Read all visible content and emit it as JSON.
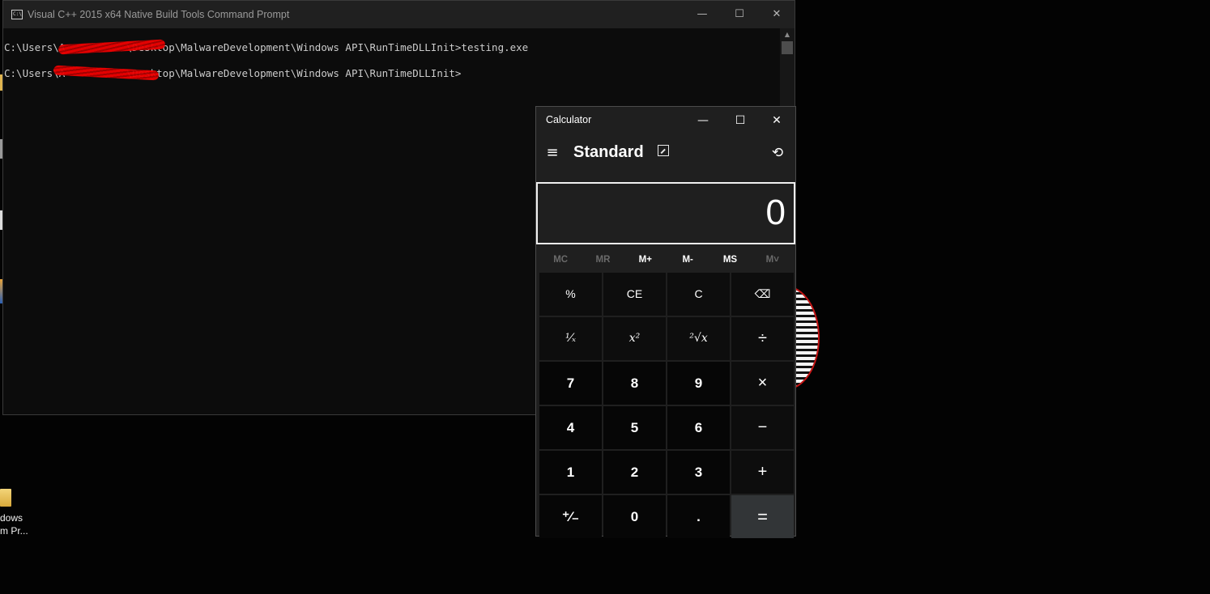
{
  "desktop": {
    "icon_label_line1": "dows",
    "icon_label_line2": "m Pr..."
  },
  "console": {
    "title": "Visual C++ 2015 x64 Native Build Tools Command Prompt",
    "icon_text": "C:\\",
    "controls": {
      "minimize": "—",
      "maximize": "☐",
      "close": "✕"
    },
    "lines": [
      "C:\\Users\\A          \\Desktop\\MalwareDevelopment\\Windows API\\RunTimeDLLInit>testing.exe",
      "C:\\Users\\A          \\Desktop\\MalwareDevelopment\\Windows API\\RunTimeDLLInit>"
    ],
    "scroll_up": "▲"
  },
  "calculator": {
    "title": "Calculator",
    "controls": {
      "minimize": "—",
      "maximize": "☐",
      "close": "✕"
    },
    "menu_icon": "≡",
    "mode": "Standard",
    "history_icon": "⟲",
    "display": "0",
    "memory": [
      {
        "label": "MC",
        "enabled": false
      },
      {
        "label": "MR",
        "enabled": false
      },
      {
        "label": "M+",
        "enabled": true
      },
      {
        "label": "M-",
        "enabled": true
      },
      {
        "label": "MS",
        "enabled": true
      },
      {
        "label": "M˅",
        "enabled": false
      }
    ],
    "keys": [
      {
        "label": "%",
        "kind": "fn",
        "name": "percent"
      },
      {
        "label": "CE",
        "kind": "fn",
        "name": "clear-entry"
      },
      {
        "label": "C",
        "kind": "fn",
        "name": "clear"
      },
      {
        "label": "⌫",
        "kind": "fn",
        "name": "backspace"
      },
      {
        "label": "¹⁄ₓ",
        "kind": "fn italic",
        "name": "reciprocal"
      },
      {
        "label": "x²",
        "kind": "fn italic",
        "name": "square"
      },
      {
        "label": "²√x",
        "kind": "fn italic",
        "name": "square-root"
      },
      {
        "label": "÷",
        "kind": "op",
        "name": "divide"
      },
      {
        "label": "7",
        "kind": "num",
        "name": "digit-7"
      },
      {
        "label": "8",
        "kind": "num",
        "name": "digit-8"
      },
      {
        "label": "9",
        "kind": "num",
        "name": "digit-9"
      },
      {
        "label": "×",
        "kind": "op",
        "name": "multiply"
      },
      {
        "label": "4",
        "kind": "num",
        "name": "digit-4"
      },
      {
        "label": "5",
        "kind": "num",
        "name": "digit-5"
      },
      {
        "label": "6",
        "kind": "num",
        "name": "digit-6"
      },
      {
        "label": "−",
        "kind": "op",
        "name": "subtract"
      },
      {
        "label": "1",
        "kind": "num",
        "name": "digit-1"
      },
      {
        "label": "2",
        "kind": "num",
        "name": "digit-2"
      },
      {
        "label": "3",
        "kind": "num",
        "name": "digit-3"
      },
      {
        "label": "+",
        "kind": "op",
        "name": "add"
      },
      {
        "label": "⁺⁄₋",
        "kind": "num",
        "name": "negate"
      },
      {
        "label": "0",
        "kind": "num",
        "name": "digit-0"
      },
      {
        "label": ".",
        "kind": "num",
        "name": "decimal"
      },
      {
        "label": "=",
        "kind": "eq",
        "name": "equals"
      }
    ]
  }
}
